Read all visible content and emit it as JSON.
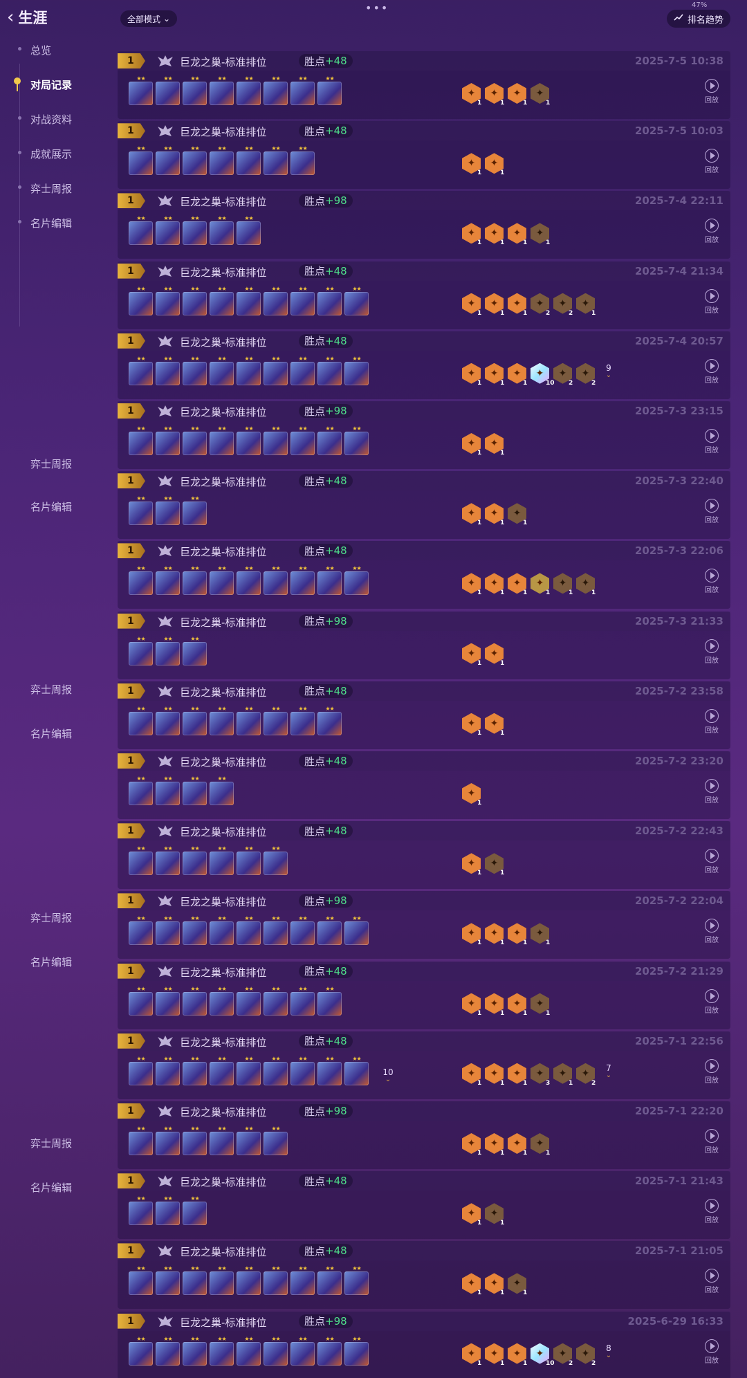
{
  "header": {
    "back_label": "生涯",
    "mode_label": "全部模式",
    "trend_label": "排名趋势",
    "battery": "47%"
  },
  "sidebar": {
    "items": [
      "总览",
      "对局记录",
      "对战资料",
      "成就展示",
      "弈士周报",
      "名片编辑"
    ],
    "active": "对局记录"
  },
  "sidebar_repeats": [
    {
      "weekly": "弈士周报",
      "card": "名片编辑"
    },
    {
      "weekly": "弈士周报",
      "card": "名片编辑"
    },
    {
      "weekly": "弈士周报",
      "card": "名片编辑"
    },
    {
      "weekly": "弈士周报",
      "card": "名片编辑"
    }
  ],
  "replay_label": "回放",
  "points_label": "胜点",
  "matches": [
    {
      "rank": "1",
      "mode": "巨龙之巢-标准排位",
      "points": "+48",
      "time": "2025-7-5 10:38",
      "units": 8,
      "more_units": "",
      "traits": [
        [
          "o",
          "1"
        ],
        [
          "o",
          "1"
        ],
        [
          "o",
          "1"
        ],
        [
          "b",
          "1"
        ]
      ],
      "more_traits": ""
    },
    {
      "rank": "1",
      "mode": "巨龙之巢-标准排位",
      "points": "+48",
      "time": "2025-7-5 10:03",
      "units": 7,
      "more_units": "",
      "traits": [
        [
          "o",
          "1"
        ],
        [
          "o",
          "1"
        ]
      ],
      "more_traits": ""
    },
    {
      "rank": "1",
      "mode": "巨龙之巢-标准排位",
      "points": "+98",
      "time": "2025-7-4 22:11",
      "units": 5,
      "more_units": "",
      "traits": [
        [
          "o",
          "1"
        ],
        [
          "o",
          "1"
        ],
        [
          "o",
          "1"
        ],
        [
          "b",
          "1"
        ]
      ],
      "more_traits": ""
    },
    {
      "rank": "1",
      "mode": "巨龙之巢-标准排位",
      "points": "+48",
      "time": "2025-7-4 21:34",
      "units": 9,
      "more_units": "",
      "traits": [
        [
          "o",
          "1"
        ],
        [
          "o",
          "1"
        ],
        [
          "o",
          "1"
        ],
        [
          "b",
          "2"
        ],
        [
          "b",
          "2"
        ],
        [
          "b",
          "1"
        ]
      ],
      "more_traits": ""
    },
    {
      "rank": "1",
      "mode": "巨龙之巢-标准排位",
      "points": "+48",
      "time": "2025-7-4 20:57",
      "units": 9,
      "more_units": "",
      "traits": [
        [
          "o",
          "1"
        ],
        [
          "o",
          "1"
        ],
        [
          "o",
          "1"
        ],
        [
          "p",
          "10"
        ],
        [
          "b",
          "2"
        ],
        [
          "b",
          "2"
        ]
      ],
      "more_traits": "9"
    },
    {
      "rank": "1",
      "mode": "巨龙之巢-标准排位",
      "points": "+98",
      "time": "2025-7-3 23:15",
      "units": 9,
      "more_units": "",
      "traits": [
        [
          "o",
          "1"
        ],
        [
          "o",
          "1"
        ]
      ],
      "more_traits": ""
    },
    {
      "rank": "1",
      "mode": "巨龙之巢-标准排位",
      "points": "+48",
      "time": "2025-7-3 22:40",
      "units": 3,
      "more_units": "",
      "traits": [
        [
          "o",
          "1"
        ],
        [
          "o",
          "1"
        ],
        [
          "b",
          "1"
        ]
      ],
      "more_traits": ""
    },
    {
      "rank": "1",
      "mode": "巨龙之巢-标准排位",
      "points": "+48",
      "time": "2025-7-3 22:06",
      "units": 9,
      "more_units": "",
      "traits": [
        [
          "o",
          "1"
        ],
        [
          "o",
          "1"
        ],
        [
          "o",
          "1"
        ],
        [
          "g",
          "1"
        ],
        [
          "b",
          "1"
        ],
        [
          "b",
          "1"
        ]
      ],
      "more_traits": ""
    },
    {
      "rank": "1",
      "mode": "巨龙之巢-标准排位",
      "points": "+98",
      "time": "2025-7-3 21:33",
      "units": 3,
      "more_units": "",
      "traits": [
        [
          "o",
          "1"
        ],
        [
          "o",
          "1"
        ]
      ],
      "more_traits": ""
    },
    {
      "rank": "1",
      "mode": "巨龙之巢-标准排位",
      "points": "+48",
      "time": "2025-7-2 23:58",
      "units": 8,
      "more_units": "",
      "traits": [
        [
          "o",
          "1"
        ],
        [
          "o",
          "1"
        ]
      ],
      "more_traits": ""
    },
    {
      "rank": "1",
      "mode": "巨龙之巢-标准排位",
      "points": "+48",
      "time": "2025-7-2 23:20",
      "units": 4,
      "more_units": "",
      "traits": [
        [
          "o",
          "1"
        ]
      ],
      "more_traits": ""
    },
    {
      "rank": "1",
      "mode": "巨龙之巢-标准排位",
      "points": "+48",
      "time": "2025-7-2 22:43",
      "units": 6,
      "more_units": "",
      "traits": [
        [
          "o",
          "1"
        ],
        [
          "b",
          "1"
        ]
      ],
      "more_traits": ""
    },
    {
      "rank": "1",
      "mode": "巨龙之巢-标准排位",
      "points": "+98",
      "time": "2025-7-2 22:04",
      "units": 9,
      "more_units": "",
      "traits": [
        [
          "o",
          "1"
        ],
        [
          "o",
          "1"
        ],
        [
          "o",
          "1"
        ],
        [
          "b",
          "1"
        ]
      ],
      "more_traits": ""
    },
    {
      "rank": "1",
      "mode": "巨龙之巢-标准排位",
      "points": "+48",
      "time": "2025-7-2 21:29",
      "units": 8,
      "more_units": "",
      "traits": [
        [
          "o",
          "1"
        ],
        [
          "o",
          "1"
        ],
        [
          "o",
          "1"
        ],
        [
          "b",
          "1"
        ]
      ],
      "more_traits": ""
    },
    {
      "rank": "1",
      "mode": "巨龙之巢-标准排位",
      "points": "+48",
      "time": "2025-7-1 22:56",
      "units": 9,
      "more_units": "10",
      "traits": [
        [
          "o",
          "1"
        ],
        [
          "o",
          "1"
        ],
        [
          "o",
          "1"
        ],
        [
          "b",
          "3"
        ],
        [
          "b",
          "1"
        ],
        [
          "b",
          "2"
        ]
      ],
      "more_traits": "7"
    },
    {
      "rank": "1",
      "mode": "巨龙之巢-标准排位",
      "points": "+98",
      "time": "2025-7-1 22:20",
      "units": 6,
      "more_units": "",
      "traits": [
        [
          "o",
          "1"
        ],
        [
          "o",
          "1"
        ],
        [
          "o",
          "1"
        ],
        [
          "b",
          "1"
        ]
      ],
      "more_traits": ""
    },
    {
      "rank": "1",
      "mode": "巨龙之巢-标准排位",
      "points": "+48",
      "time": "2025-7-1 21:43",
      "units": 3,
      "more_units": "",
      "traits": [
        [
          "o",
          "1"
        ],
        [
          "b",
          "1"
        ]
      ],
      "more_traits": ""
    },
    {
      "rank": "1",
      "mode": "巨龙之巢-标准排位",
      "points": "+48",
      "time": "2025-7-1 21:05",
      "units": 9,
      "more_units": "",
      "traits": [
        [
          "o",
          "1"
        ],
        [
          "o",
          "1"
        ],
        [
          "b",
          "1"
        ]
      ],
      "more_traits": ""
    },
    {
      "rank": "1",
      "mode": "巨龙之巢-标准排位",
      "points": "+98",
      "time": "2025-6-29 16:33",
      "units": 9,
      "more_units": "",
      "traits": [
        [
          "o",
          "1"
        ],
        [
          "o",
          "1"
        ],
        [
          "o",
          "1"
        ],
        [
          "p",
          "10"
        ],
        [
          "b",
          "2"
        ],
        [
          "b",
          "2"
        ]
      ],
      "more_traits": "8"
    }
  ]
}
